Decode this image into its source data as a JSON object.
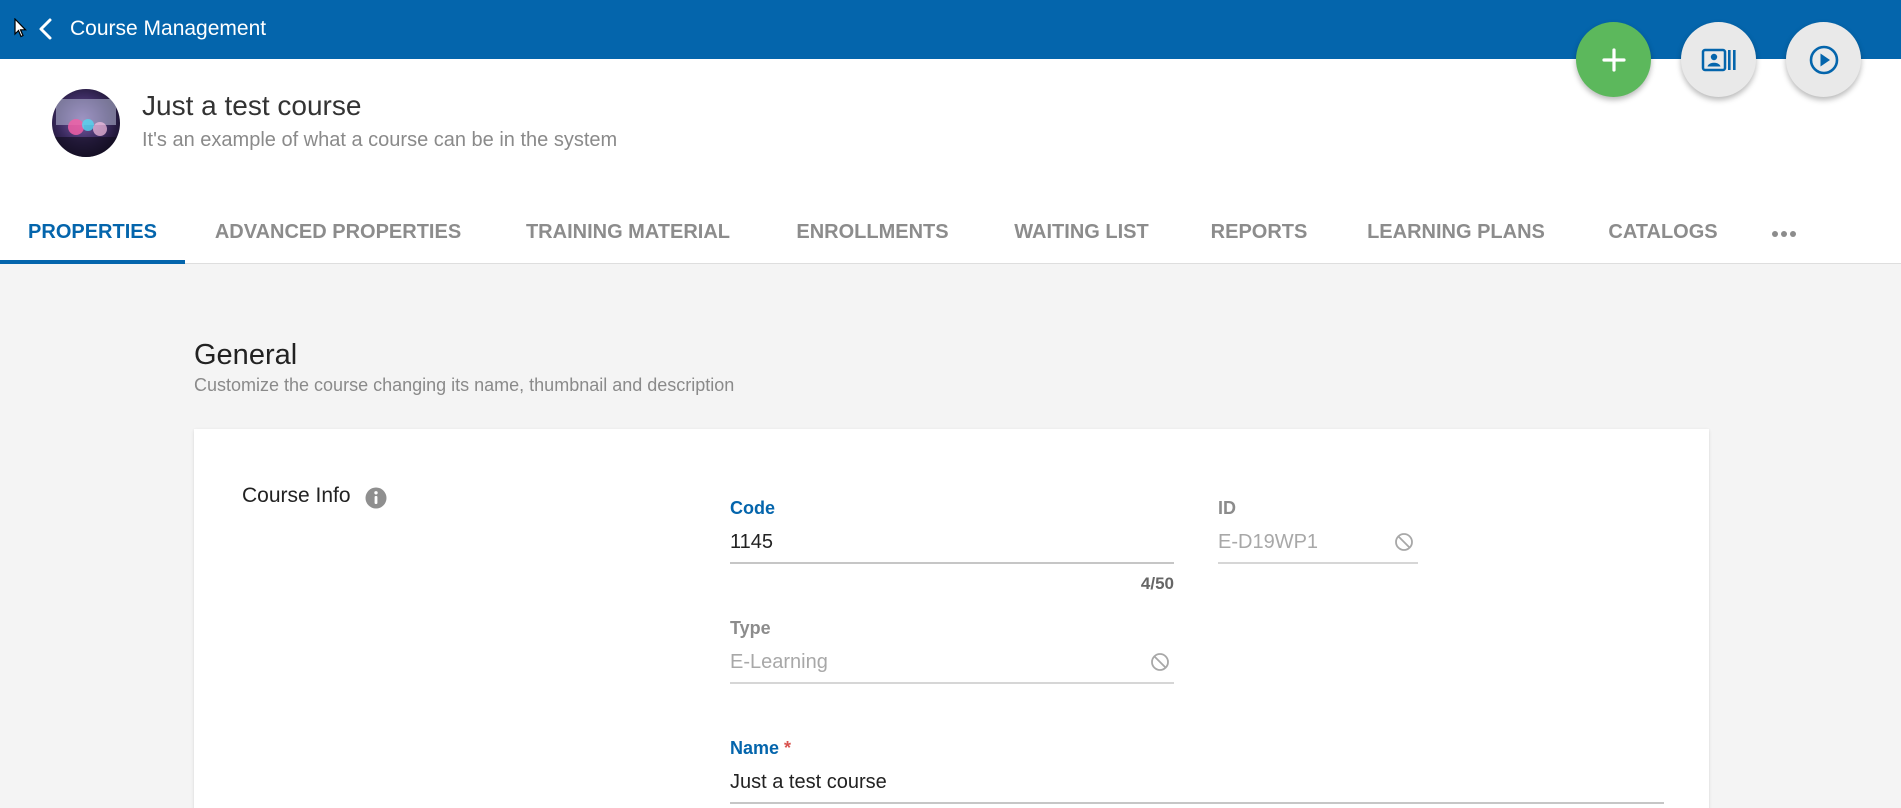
{
  "topbar": {
    "title": "Course Management"
  },
  "course": {
    "title": "Just a test course",
    "description": "It's an example of what a course can be in the system"
  },
  "tabs": [
    {
      "label": "PROPERTIES"
    },
    {
      "label": "ADVANCED PROPERTIES"
    },
    {
      "label": "TRAINING MATERIAL"
    },
    {
      "label": "ENROLLMENTS"
    },
    {
      "label": "WAITING LIST"
    },
    {
      "label": "REPORTS"
    },
    {
      "label": "LEARNING PLANS"
    },
    {
      "label": "CATALOGS"
    }
  ],
  "general": {
    "title": "General",
    "subtitle": "Customize the course changing its name, thumbnail and description"
  },
  "course_info": {
    "label": "Course Info",
    "code": {
      "label": "Code",
      "value": "1145",
      "counter": "4/50"
    },
    "id": {
      "label": "ID",
      "value": "E-D19WP1"
    },
    "type": {
      "label": "Type",
      "value": "E-Learning"
    },
    "name": {
      "label": "Name",
      "required_mark": "*",
      "value": "Just a test course"
    }
  },
  "colors": {
    "primary": "#0465ac",
    "add": "#5cb85c"
  }
}
